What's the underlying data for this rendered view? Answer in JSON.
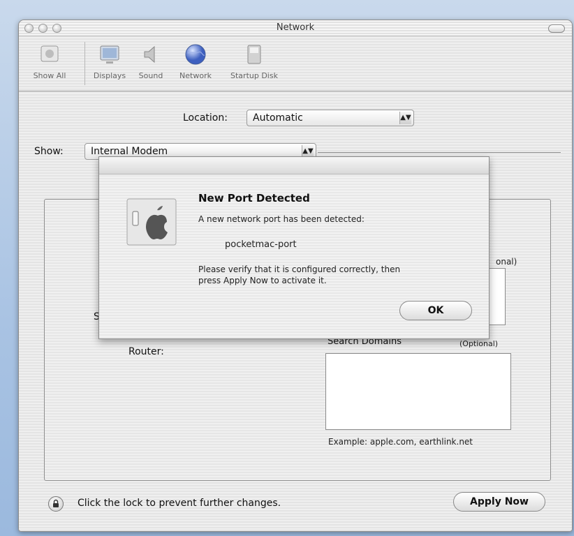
{
  "window": {
    "title": "Network"
  },
  "toolbar": {
    "items": [
      {
        "label": "Show All",
        "icon": "show-all-icon"
      },
      {
        "label": "Displays",
        "icon": "display-icon"
      },
      {
        "label": "Sound",
        "icon": "speaker-icon"
      },
      {
        "label": "Network",
        "icon": "globe-icon"
      },
      {
        "label": "Startup Disk",
        "icon": "disk-icon"
      }
    ]
  },
  "location": {
    "label": "Location:",
    "value": "Automatic"
  },
  "show": {
    "label": "Show:",
    "value": "Internal Modem"
  },
  "panel": {
    "dns_optional": "onal)",
    "s_fragment": "S",
    "router_label": "Router:",
    "search_domains_label": "Search Domains",
    "search_domains_optional": "(Optional)",
    "example": "Example: apple.com, earthlink.net"
  },
  "alert": {
    "title": "New Port Detected",
    "line1": "A new network port has been detected:",
    "port_name": "pocketmac-port",
    "line2": "Please verify that it is configured correctly, then",
    "line3": "press Apply Now to activate it.",
    "ok_label": "OK"
  },
  "footer": {
    "lock_text": "Click the lock to prevent further changes.",
    "apply_label": "Apply Now"
  }
}
